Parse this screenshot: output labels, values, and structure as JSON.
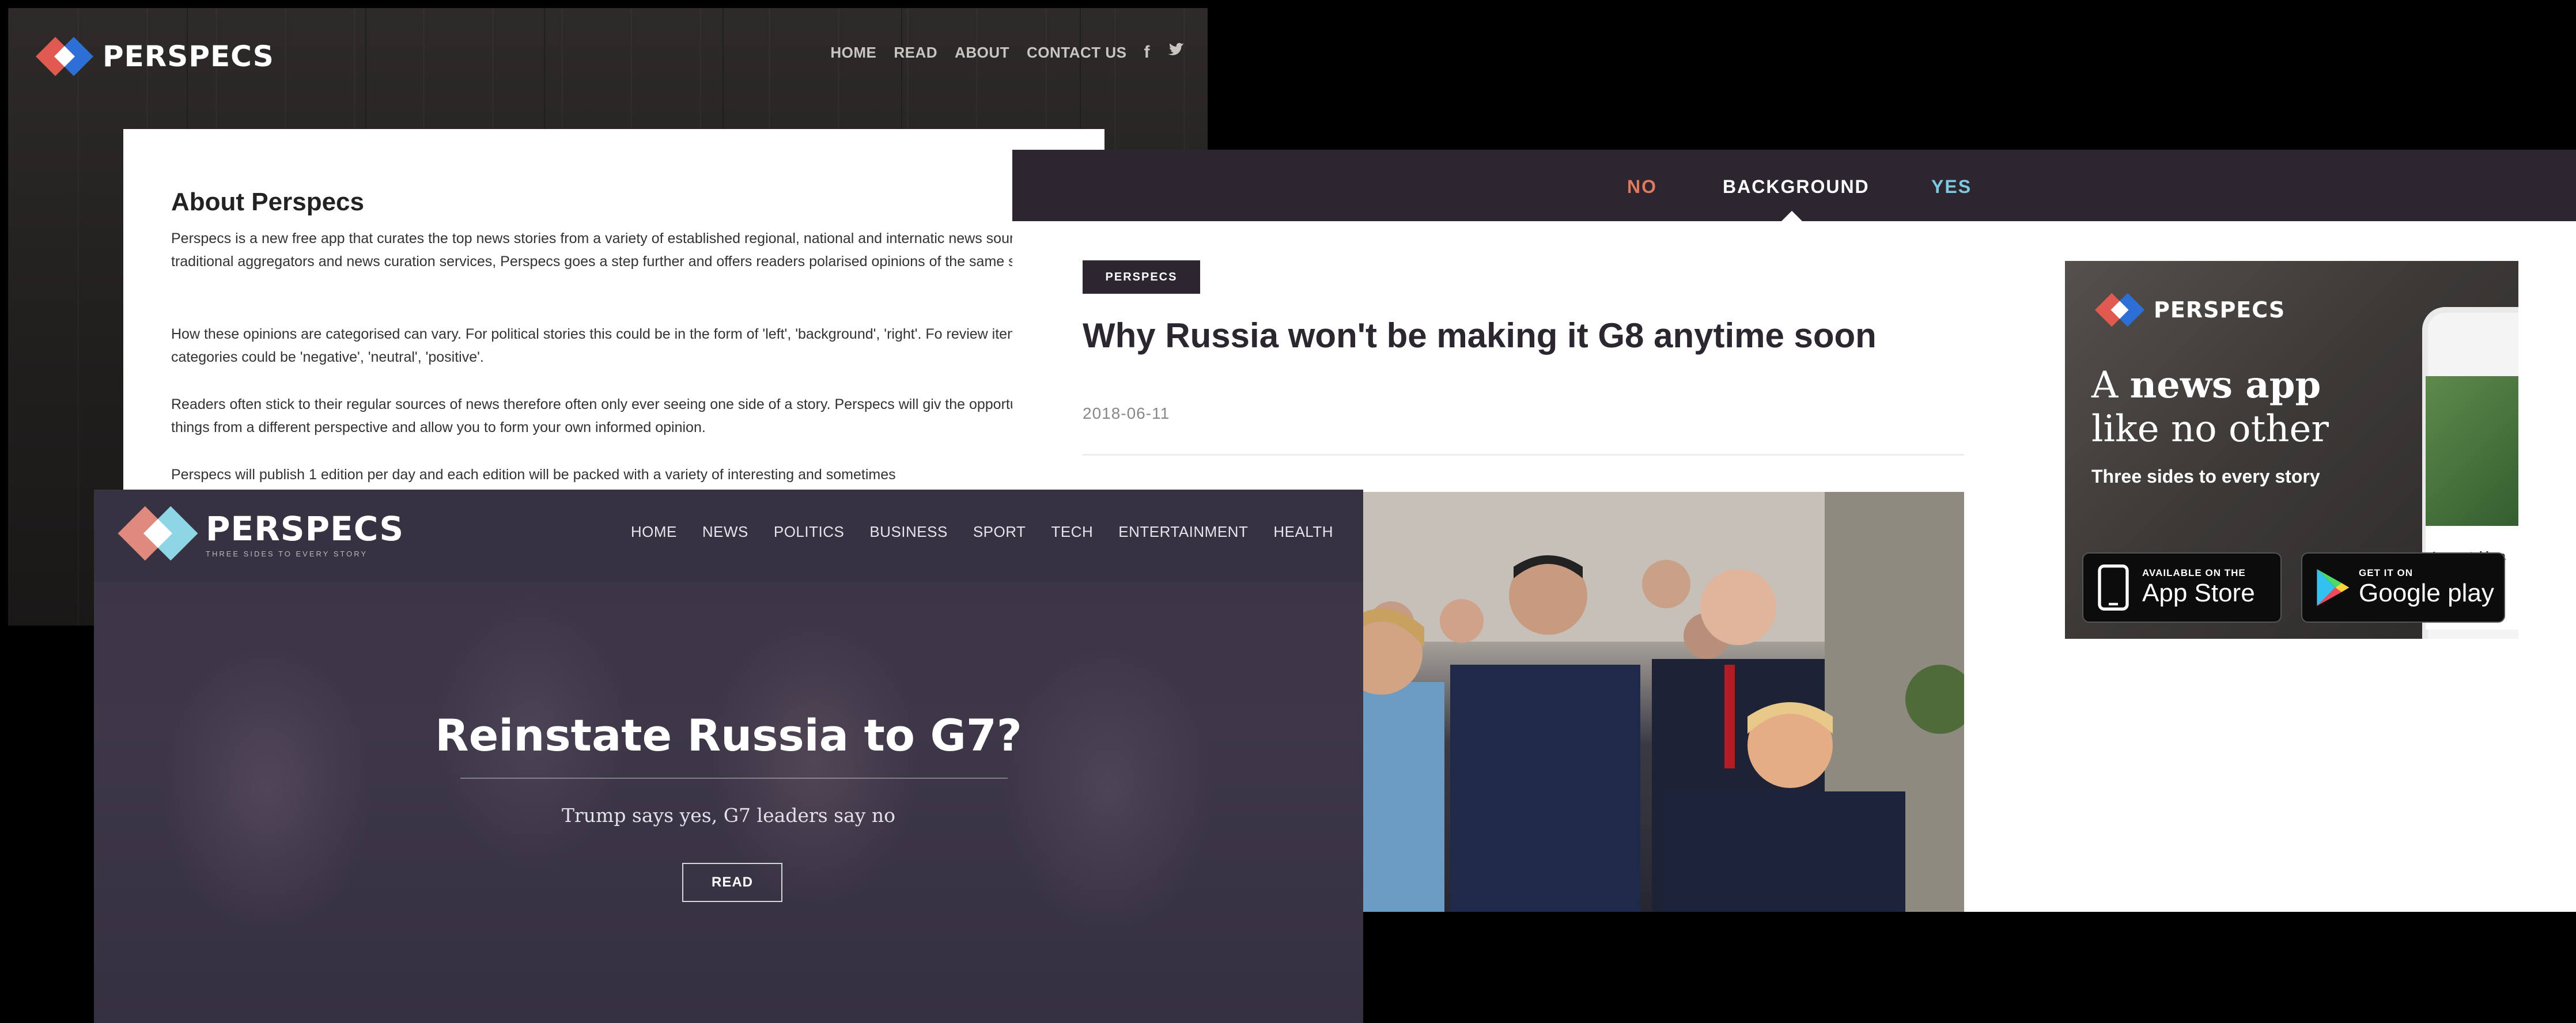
{
  "site_a": {
    "logo_text": "PERSPECS",
    "nav": [
      "HOME",
      "READ",
      "ABOUT",
      "CONTACT US"
    ],
    "social": [
      "f",
      "twitter"
    ],
    "about": {
      "heading": "About Perspecs",
      "paragraphs": [
        "Perspecs is a new free app that curates the top news stories from a variety of established regional, national and internatic news sources. Unlike traditional aggregators and news curation services, Perspecs goes a step further and offers readers polarised opinions of the same story.",
        "How these opinions are categorised can vary. For political stories this could be in the form of 'left', 'background', 'right'. Fo review items the categories could be 'negative', 'neutral', 'positive'.",
        "Readers often stick to their regular sources of news therefore often only ever seeing one side of a story. Perspecs will giv the opportunity to see things from a different perspective and allow you to form your own informed opinion.",
        "Perspecs will publish 1 edition per day and each edition will be packed with a variety of interesting and sometimes"
      ]
    }
  },
  "article": {
    "tabs": {
      "no": "NO",
      "background": "BACKGROUND",
      "yes": "YES"
    },
    "badge": "PERSPECS",
    "title": "Why Russia won't be making it G8 anytime soon",
    "date": "2018-06-11"
  },
  "ad": {
    "logo_text": "PERSPECS",
    "headline_a": "A ",
    "headline_b": "news app",
    "headline_c": " like no other",
    "subline": "Three sides to every story",
    "app_store_small": "AVAILABLE ON THE",
    "app_store_big": "App Store",
    "google_small": "GET IT ON",
    "google_big": "Google play",
    "phone_text": "Is mental hea improving?"
  },
  "site_c": {
    "logo_text": "PERSPECS",
    "tagline": "THREE SIDES TO EVERY STORY",
    "nav": [
      "HOME",
      "NEWS",
      "POLITICS",
      "BUSINESS",
      "SPORT",
      "TECH",
      "ENTERTAINMENT",
      "HEALTH"
    ],
    "hero_title": "Reinstate Russia to G7?",
    "hero_sub": "Trump says yes, G7 leaders say no",
    "read_label": "READ"
  },
  "colors": {
    "logo_red": "#e05a4f",
    "logo_blue": "#2e6fd6",
    "dark": "#2b2630",
    "no_tab": "#e07a5f",
    "yes_tab": "#7ec9e0"
  }
}
